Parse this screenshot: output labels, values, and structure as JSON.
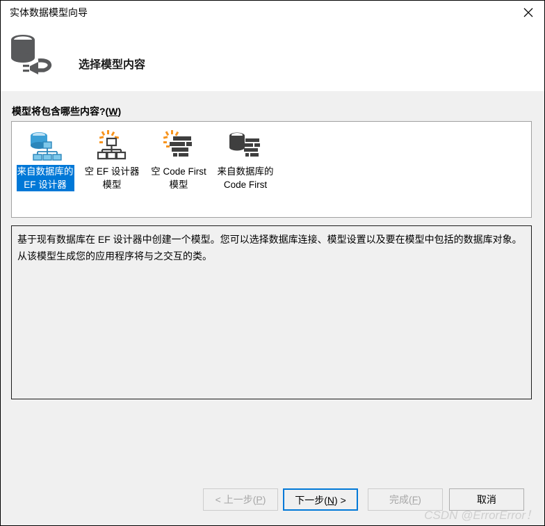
{
  "window": {
    "title": "实体数据模型向导",
    "close_label": "×"
  },
  "header": {
    "heading": "选择模型内容",
    "icon": "database-plug-icon"
  },
  "main": {
    "section_label_text": "模型将包含哪些内容?(",
    "section_label_accesskey": "W",
    "section_label_suffix": ")",
    "options": [
      {
        "label": "来自数据库的\nEF 设计器",
        "icon": "database-designer-icon",
        "selected": true
      },
      {
        "label": "空 EF 设计器\n模型",
        "icon": "empty-designer-icon",
        "selected": false
      },
      {
        "label": "空 Code First\n模型",
        "icon": "empty-code-first-icon",
        "selected": false
      },
      {
        "label": "来自数据库的\nCode First",
        "icon": "database-code-first-icon",
        "selected": false
      }
    ],
    "description": "基于现有数据库在 EF 设计器中创建一个模型。您可以选择数据库连接、模型设置以及要在模型中包括的数据库对象。从该模型生成您的应用程序将与之交互的类。"
  },
  "footer": {
    "back": {
      "prefix": "< 上一步(",
      "accesskey": "P",
      "suffix": ")"
    },
    "next": {
      "prefix": "下一步(",
      "accesskey": "N",
      "suffix": ") >"
    },
    "finish": {
      "prefix": "完成(",
      "accesskey": "F",
      "suffix": ")"
    },
    "cancel": {
      "prefix": "取消",
      "accesskey": "",
      "suffix": ""
    }
  },
  "watermark": "CSDN @ErrorError！",
  "colors": {
    "selection_blue": "#0078d7",
    "panel_bg": "#f0f0f0",
    "white": "#ffffff",
    "icon_gray": "#58595b",
    "icon_blue": "#3b9fd6",
    "icon_orange": "#f7941e"
  }
}
